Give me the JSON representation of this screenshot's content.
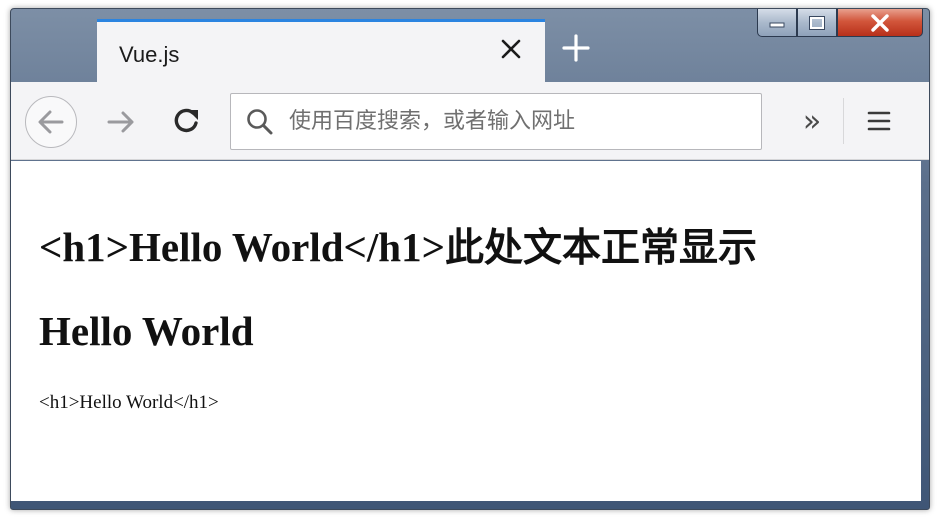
{
  "tab": {
    "title": "Vue.js"
  },
  "address_bar": {
    "placeholder": "使用百度搜索，或者输入网址",
    "value": ""
  },
  "toolbar": {
    "overflow_label": "»"
  },
  "icons": {
    "back": "arrow-left-icon",
    "forward": "arrow-right-icon",
    "reload": "reload-icon",
    "search": "search-icon",
    "menu": "hamburger-menu-icon",
    "close_tab": "close-icon",
    "new_tab": "plus-icon"
  },
  "content": {
    "heading1_raw": "<h1>Hello World</h1>",
    "heading1_suffix": "此处文本正常显示",
    "heading2": "Hello World",
    "plain_raw": "<h1>Hello World</h1>"
  },
  "colors": {
    "tab_accent": "#2b84e0",
    "close_button": "#c83c22"
  }
}
